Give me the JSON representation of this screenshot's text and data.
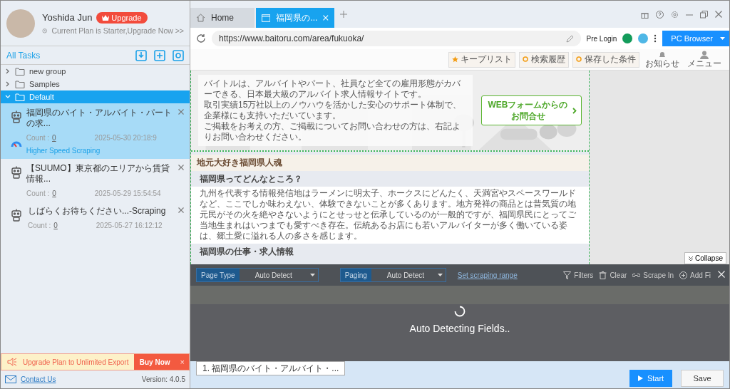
{
  "user": {
    "name": "Yoshida Jun",
    "upgrade": "Upgrade",
    "plan": "Current Plan is Starter,Upgrade Now >>"
  },
  "tasks_header": {
    "title": "All Tasks"
  },
  "groups": [
    {
      "name": "new group",
      "expanded": false,
      "selected": false
    },
    {
      "name": "Samples",
      "expanded": false,
      "selected": false
    },
    {
      "name": "Default",
      "expanded": true,
      "selected": true
    }
  ],
  "tasks": [
    {
      "title": "福岡県のバイト・アルバイト・パートの求...",
      "count_label": "Count :",
      "count": "0",
      "date": "2025-05-30 20:18:9",
      "selected": true,
      "mode": "Higher Speed Scraping"
    },
    {
      "title": "【SUUMO】東京都のエリアから賃貸情報...",
      "count_label": "Count :",
      "count": "0",
      "date": "2025-05-29 15:54:54",
      "selected": false
    },
    {
      "title": "しばらくお待ちください...-Scraping",
      "count_label": "Count :",
      "count": "0",
      "date": "2025-05-27 16:12:12",
      "selected": false
    }
  ],
  "promo": {
    "text": "Upgrade Plan to Unlimited Export",
    "button": "Buy Now",
    "close": "×"
  },
  "footer_left": {
    "contact": "Contact Us",
    "version": "Version: 4.0.5"
  },
  "tabs": [
    {
      "label": "Home",
      "kind": "home",
      "selected": false
    },
    {
      "label": "福岡県の...",
      "kind": "page",
      "selected": true
    }
  ],
  "address": {
    "url": "https://www.baitoru.com/area/fukuoka/",
    "pre_login": "Pre Login",
    "browser": "PC Browser"
  },
  "site_nav": {
    "buttons": [
      "キープリスト",
      "検索履歴",
      "保存した条件"
    ],
    "notify": "お知らせ",
    "menu": "メニュー"
  },
  "intro": {
    "lines": [
      "バイトルは、アルバイトやパート、社員など全ての雇用形態がカバーできる、日本最大級のアルバイト求人情報サイトです。",
      "取引実績15万社以上のノウハウを活かした安心のサポート体制で、企業様にも支持いただいています。",
      "ご掲載をお考えの方、ご掲載についてお問い合わせの方は、右記よりお問い合わせください。"
    ],
    "button_lines": [
      "WEBフォームからの",
      "お問合せ"
    ]
  },
  "section": {
    "heading": "地元大好き福岡県人魂",
    "subheading": "福岡県ってどんなところ？",
    "paragraph": "九州を代表する情報発信地はラーメンに明太子、ホークスにどんたく、天満宮やスペースワールドなど、ここでしか味わえない、体験できないことが多くあります。地方発祥の商品とは昔気質の地元民がその火を絶やさないようにとせっせと伝承しているのが一般的ですが、福岡県民にとってご当地生まれはいつまでも愛すべき存在。伝統あるお店にも若いアルバイターが多く働いている姿は、郷土愛に溢れる人の多さを感じます。",
    "subheading2": "福岡県の仕事・求人情報"
  },
  "collapse": "Collapse",
  "panel": {
    "page_type": {
      "label": "Page Type",
      "value": "Auto Detect"
    },
    "paging": {
      "label": "Paging",
      "value": "Auto Detect"
    },
    "range": "Set scraping range",
    "tools": [
      "Filters",
      "Clear",
      "Scrape In",
      "Add Fi"
    ],
    "status": "Auto Detecting Fields.."
  },
  "bottom": {
    "step": "1. 福岡県のバイト・アルバイト・...",
    "start": "Start",
    "save": "Save"
  }
}
